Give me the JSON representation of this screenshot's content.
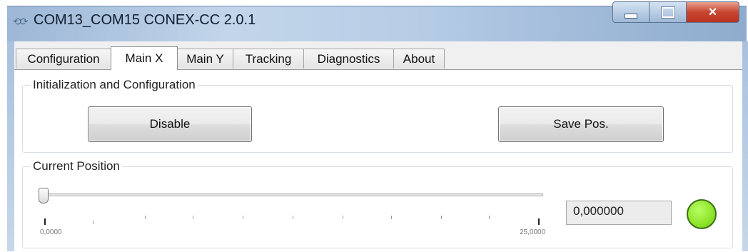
{
  "window": {
    "title": "COM13_COM15  CONEX-CC 2.0.1",
    "app_icon": "link-icon",
    "controls": {
      "minimize": "minimize-icon",
      "maximize": "maximize-icon",
      "close": "×"
    }
  },
  "tabs": [
    {
      "label": "Configuration",
      "active": false
    },
    {
      "label": "Main X",
      "active": true
    },
    {
      "label": "Main Y",
      "active": false
    },
    {
      "label": "Tracking",
      "active": false
    },
    {
      "label": "Diagnostics",
      "active": false
    },
    {
      "label": "About",
      "active": false
    }
  ],
  "init_group": {
    "label": "Initialization and Configuration",
    "disable_button": "Disable",
    "save_button": "Save Pos."
  },
  "position_group": {
    "label": "Current Position",
    "slider": {
      "min_label": "0,0000",
      "max_label": "25,0000",
      "value": 0
    },
    "value_text": "0,000000",
    "status_color": "#8ee32a"
  }
}
